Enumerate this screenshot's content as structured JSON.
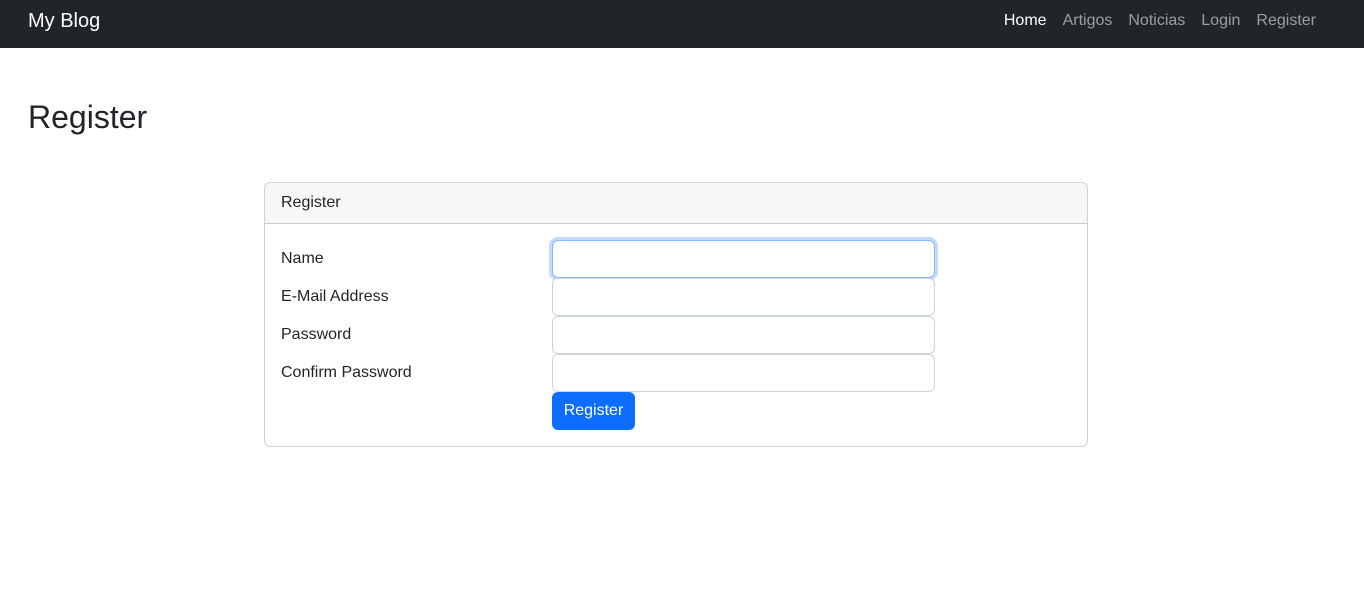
{
  "navbar": {
    "brand": "My Blog",
    "links": [
      {
        "label": "Home",
        "active": true
      },
      {
        "label": "Artigos",
        "active": false
      },
      {
        "label": "Noticias",
        "active": false
      },
      {
        "label": "Login",
        "active": false
      },
      {
        "label": "Register",
        "active": false
      }
    ]
  },
  "page": {
    "title": "Register"
  },
  "card": {
    "header": "Register",
    "fields": [
      {
        "label": "Name",
        "value": "",
        "focused": true
      },
      {
        "label": "E-Mail Address",
        "value": "",
        "focused": false
      },
      {
        "label": "Password",
        "value": "",
        "focused": false
      },
      {
        "label": "Confirm Password",
        "value": "",
        "focused": false
      }
    ],
    "submit_label": "Register"
  },
  "colors": {
    "navbar_bg": "#212529",
    "primary": "#0d6efd",
    "focus_border": "#86b7fe"
  }
}
